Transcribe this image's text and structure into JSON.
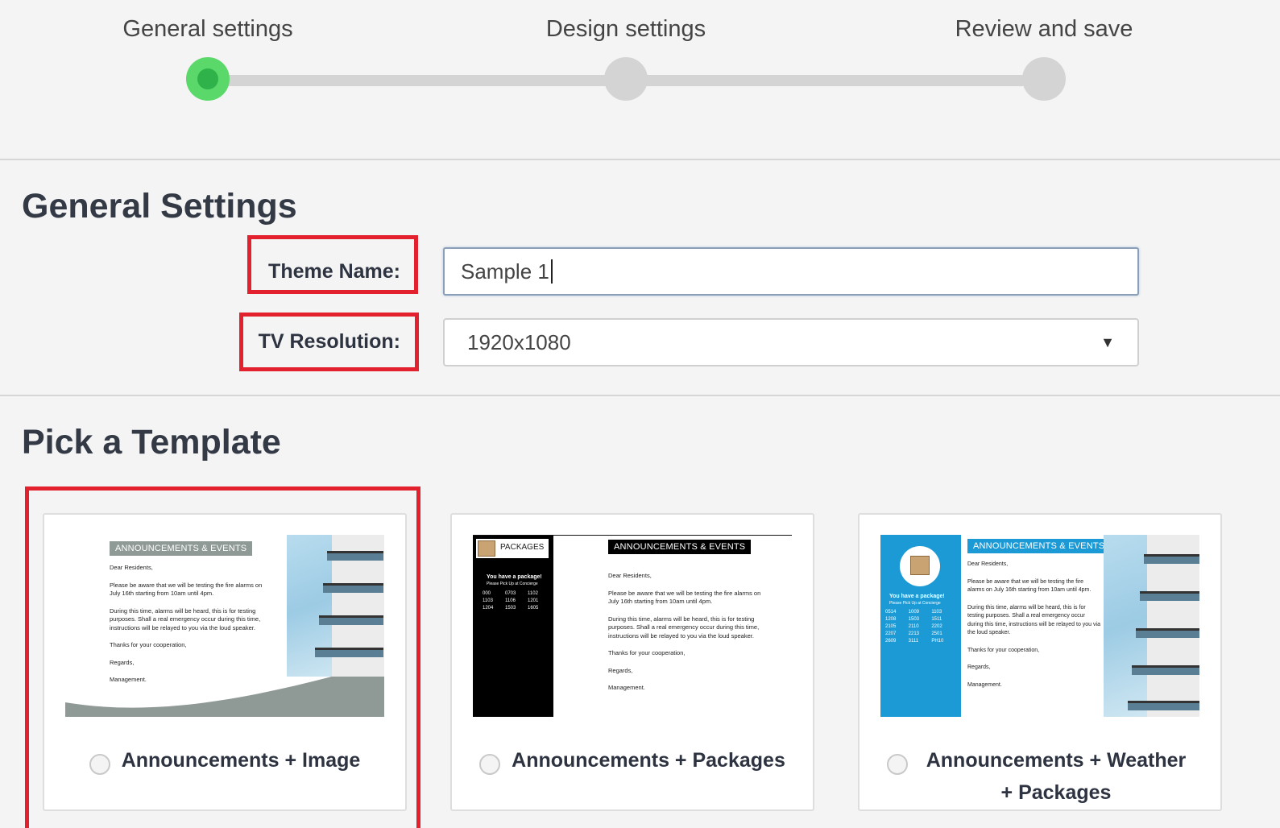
{
  "stepper": {
    "steps": [
      {
        "label": "General settings"
      },
      {
        "label": "Design settings"
      },
      {
        "label": "Review and save"
      }
    ],
    "active_step": 1,
    "colors": {
      "active": "#5ad86a",
      "inactive": "#d4d4d4"
    }
  },
  "general": {
    "heading": "General Settings",
    "theme_label": "Theme Name:",
    "theme_value": "Sample 1",
    "resolution_label": "TV Resolution:",
    "resolution_value": "1920x1080"
  },
  "templates": {
    "heading": "Pick a Template",
    "items": [
      {
        "label": "Announcements + Image",
        "selected": false
      },
      {
        "label": "Announcements + Packages",
        "selected": false
      },
      {
        "label": "Announcements + Weather + Packages",
        "selected": false
      }
    ],
    "preview": {
      "banner": "ANNOUNCEMENTS & EVENTS",
      "packages_tag": "PACKAGES",
      "package_heading": "You have a package!",
      "package_sub": "Please Pick Up at Concierge",
      "letter": [
        "Dear Residents,",
        "Please be aware that we will be testing the fire alarms on July 16th starting from 10am until 4pm.",
        "During this time, alarms will be heard, this is for testing purposes. Shall a real emergency occur during this time, instructions will be relayed to you via the loud speaker.",
        "Thanks for your cooperation,",
        "Regards,",
        "Management."
      ],
      "units_a": [
        "000",
        "0703",
        "1102",
        "1103",
        "1106",
        "1201",
        "1204",
        "1503",
        "1605"
      ],
      "units_b": [
        "0514",
        "1009",
        "1103",
        "1208",
        "1503",
        "1511",
        "2105",
        "2110",
        "2202",
        "2207",
        "2213",
        "2501",
        "2609",
        "3111",
        "PH10"
      ]
    }
  },
  "highlight_color": "#e3202d"
}
